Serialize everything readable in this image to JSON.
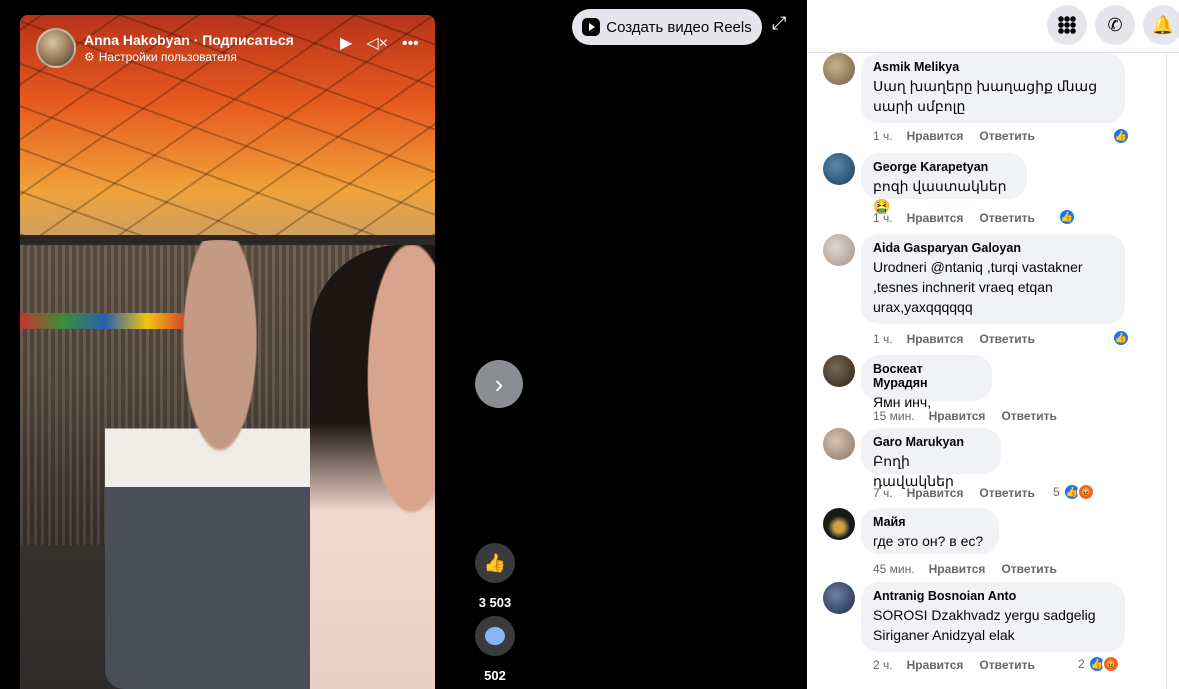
{
  "video": {
    "author_line": "Anna Hakobyan · Подписаться",
    "settings_label": "Настройки пользователя",
    "play_icon": "▶",
    "mute_icon": "🔇",
    "more_icon": "•••",
    "likes_count": "3 503",
    "comments_count": "502"
  },
  "toolbar": {
    "create_reels_label": "Создать видео Reels"
  },
  "comments": [
    {
      "author": "Asmik Melikya",
      "text": "Սաղ խաղերը խաղացիք մնաց սարի սմբոլը",
      "time": "1 ч.",
      "like": "Нравится",
      "reply": "Ответить",
      "reaction_count": ""
    },
    {
      "author": "George Karapetyan",
      "text": "բոզի վաստակներ🤮",
      "time": "1 ч.",
      "like": "Нравится",
      "reply": "Ответить",
      "reaction_count": ""
    },
    {
      "author": "Aida Gasparyan Galoyan",
      "text": "Urodneri @ntaniq ,turqi vastakner ,tesnes inchnerit vraeq etqan urax,yaxqqqqqq",
      "time": "1 ч.",
      "like": "Нравится",
      "reply": "Ответить",
      "reaction_count": ""
    },
    {
      "author": "Воскеат Мурадян",
      "text": "Ямн инч,",
      "time": "15 мин.",
      "like": "Нравится",
      "reply": "Ответить",
      "reaction_count": ""
    },
    {
      "author": "Garo Marukyan",
      "text": "Բողի դավակներ",
      "time": "7 ч.",
      "like": "Нравится",
      "reply": "Ответить",
      "reaction_count": "5"
    },
    {
      "author": "Майя",
      "text": "где это он? в ес?",
      "time": "45 мин.",
      "like": "Нравится",
      "reply": "Ответить",
      "reaction_count": ""
    },
    {
      "author": "Antranig Bosnoian Anto",
      "text": "SOROSI Dzakhvadz yergu sadgelig Siriganer Anidzyal elak",
      "time": "2 ч.",
      "like": "Нравится",
      "reply": "Ответить",
      "reaction_count": "2"
    }
  ],
  "icons": {
    "menu": "grid-icon",
    "messenger": "messenger-icon",
    "notifications": "bell-icon"
  }
}
